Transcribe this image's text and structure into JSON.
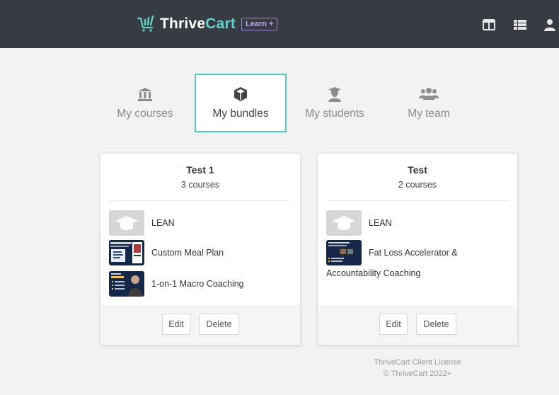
{
  "header": {
    "brand_main": "Thrive",
    "brand_accent": "Cart",
    "badge": "Learn +",
    "icons": [
      "columns-icon",
      "list-icon",
      "user-icon"
    ]
  },
  "tabs": [
    {
      "label": "My courses",
      "icon": "bank-icon",
      "active": false
    },
    {
      "label": "My bundles",
      "icon": "cube-icon",
      "active": true
    },
    {
      "label": "My students",
      "icon": "graduate-icon",
      "active": false
    },
    {
      "label": "My team",
      "icon": "team-icon",
      "active": false
    }
  ],
  "bundles": [
    {
      "title": "Test 1",
      "subtitle": "3 courses",
      "courses": [
        {
          "name": "LEAN",
          "thumb": "graduation-cap-placeholder"
        },
        {
          "name": "Custom Meal Plan",
          "thumb": "meal-plan-thumbnail"
        },
        {
          "name": "1-on-1 Macro Coaching",
          "thumb": "macro-coaching-thumbnail"
        }
      ],
      "edit_label": "Edit",
      "delete_label": "Delete"
    },
    {
      "title": "Test",
      "subtitle": "2 courses",
      "courses": [
        {
          "name": "LEAN",
          "thumb": "graduation-cap-placeholder"
        },
        {
          "name": "Fat Loss Accelerator &",
          "name_line2": "Accountability Coaching",
          "thumb": "fat-loss-thumbnail"
        }
      ],
      "edit_label": "Edit",
      "delete_label": "Delete"
    }
  ],
  "footer": {
    "line1": "ThriveCart Client License",
    "line2": "© ThriveCart 2022+"
  },
  "colors": {
    "topbar": "#363b44",
    "accent": "#58c9c0",
    "badge": "#a98bdc",
    "background": "#f2f2f2"
  }
}
